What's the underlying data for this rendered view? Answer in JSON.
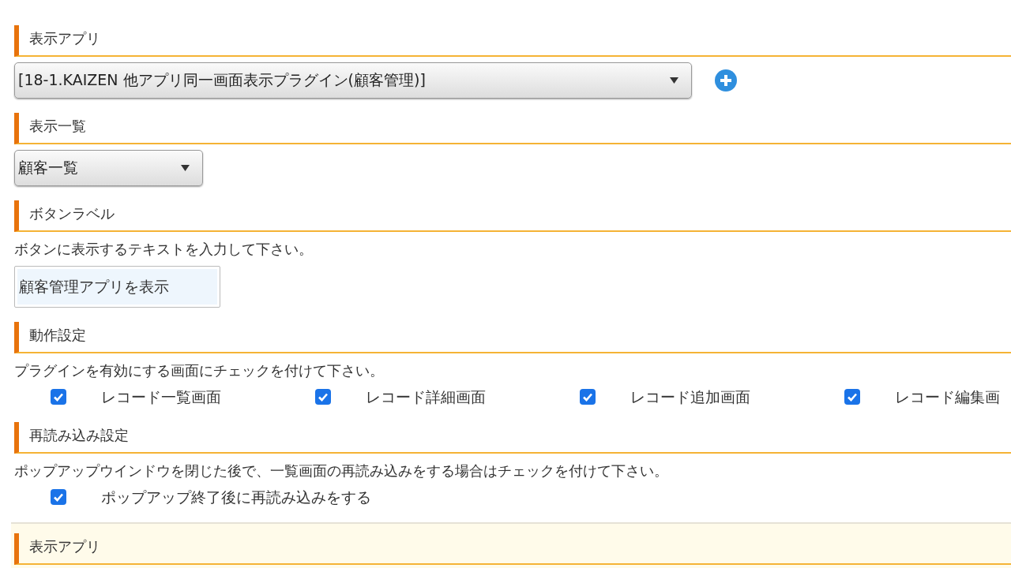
{
  "sections": [
    {
      "kind": "select",
      "heading": "表示アプリ",
      "value": "[18-1.KAIZEN 他アプリ同一画面表示プラグイン(顧客管理)]",
      "wide": true,
      "add_button": true
    },
    {
      "kind": "select",
      "heading": "表示一覧",
      "value": "顧客一覧",
      "wide": false,
      "add_button": false
    },
    {
      "kind": "input",
      "heading": "ボタンラベル",
      "description": "ボタンに表示するテキストを入力して下さい。",
      "value": "顧客管理アプリを表示"
    },
    {
      "kind": "checks",
      "heading": "動作設定",
      "description": "プラグインを有効にする画面にチェックを付けて下さい。",
      "options": [
        {
          "label": "レコード一覧画面",
          "checked": true
        },
        {
          "label": "レコード詳細画面",
          "checked": true
        },
        {
          "label": "レコード追加画面",
          "checked": true
        },
        {
          "label": "レコード編集画",
          "checked": true
        }
      ]
    },
    {
      "kind": "checks",
      "heading": "再読み込み設定",
      "description": "ポップアップウインドウを閉じた後で、一覧画面の再読み込みをする場合はチェックを付けて下さい。",
      "options": [
        {
          "label": "ポップアップ終了後に再読み込みをする",
          "checked": true
        }
      ]
    }
  ],
  "next_panel": {
    "heading": "表示アプリ"
  }
}
